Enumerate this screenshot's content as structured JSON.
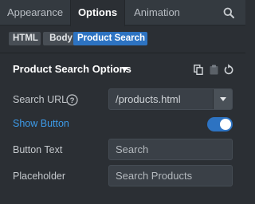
{
  "tabs": [
    {
      "label": "Appearance",
      "active": false
    },
    {
      "label": "Options",
      "active": true
    },
    {
      "label": "Animation",
      "active": false
    }
  ],
  "breadcrumb": [
    "HTML",
    "Body",
    "Product Search"
  ],
  "section": {
    "title": "Product Search Options"
  },
  "fields": {
    "search_url": {
      "label": "Search URL",
      "value": "/products.html"
    },
    "show_button": {
      "label": "Show Button",
      "enabled": true
    },
    "button_text": {
      "label": "Button Text",
      "placeholder": "Search"
    },
    "placeholder": {
      "label": "Placeholder",
      "placeholder": "Search Products"
    }
  },
  "colors": {
    "accent": "#2d73c2",
    "link": "#3d9be9",
    "background": "#2b2f34"
  },
  "icons": {
    "search": "search-icon",
    "caret": "caret-down-icon",
    "copy": "copy-icon",
    "paste": "clipboard-icon",
    "reset": "reset-icon",
    "help": "help-icon",
    "dropdown": "chevron-down-icon"
  }
}
